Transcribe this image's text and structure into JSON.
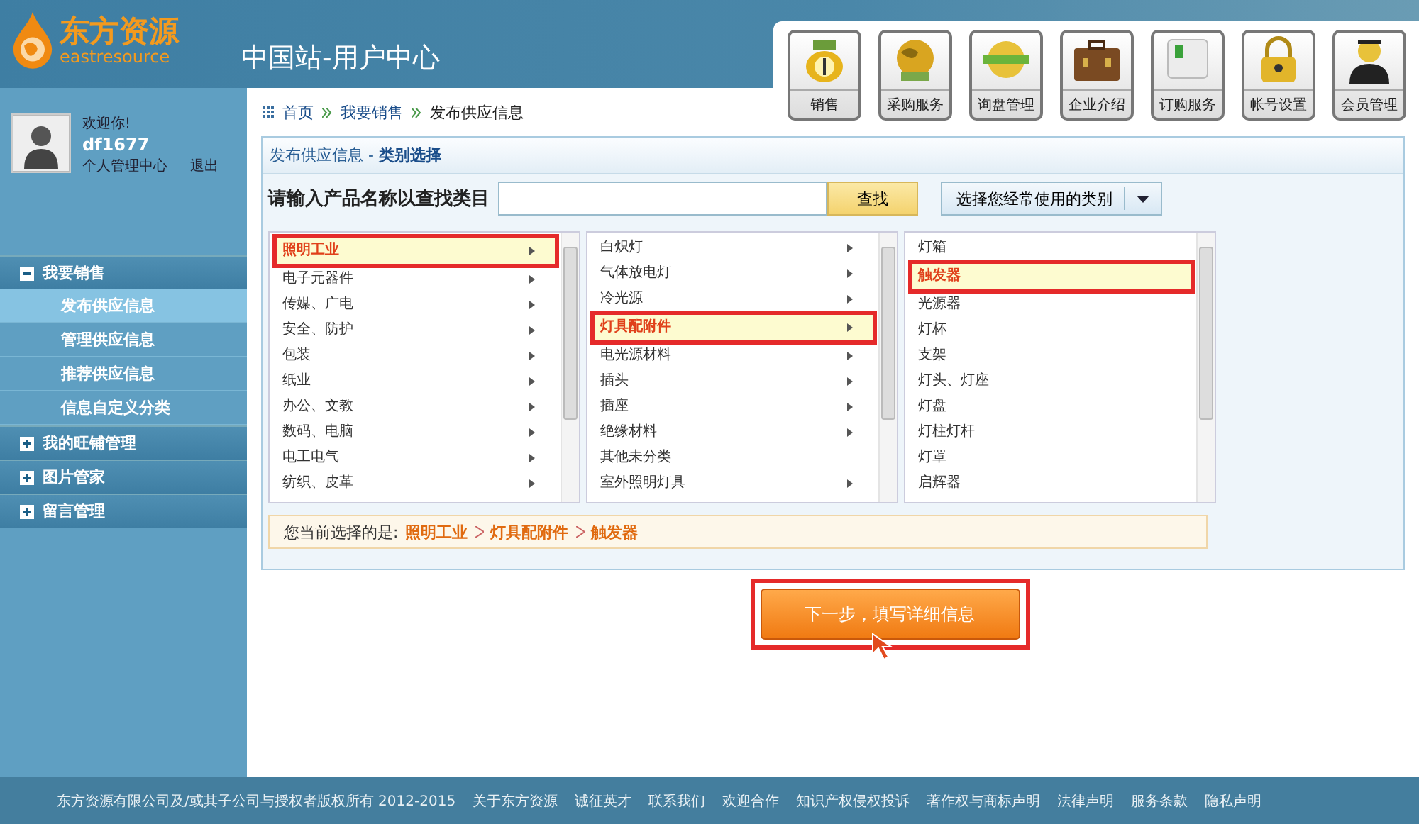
{
  "header": {
    "logo_cn": "东方资源",
    "logo_en": "eastresource",
    "site_title": "中国站-用户中心"
  },
  "nav_tiles": [
    {
      "label": "销售"
    },
    {
      "label": "采购服务"
    },
    {
      "label": "询盘管理"
    },
    {
      "label": "企业介绍"
    },
    {
      "label": "订购服务"
    },
    {
      "label": "帐号设置"
    },
    {
      "label": "会员管理"
    }
  ],
  "user": {
    "greeting": "欢迎你!",
    "name": "df1677",
    "center_link": "个人管理中心",
    "logout": "退出"
  },
  "sidebar": [
    {
      "label": "我要销售",
      "expanded": true,
      "children": [
        {
          "label": "发布供应信息",
          "selected": true
        },
        {
          "label": "管理供应信息",
          "selected": false
        },
        {
          "label": "推荐供应信息",
          "selected": false
        },
        {
          "label": "信息自定义分类",
          "selected": false
        }
      ]
    },
    {
      "label": "我的旺铺管理",
      "expanded": false
    },
    {
      "label": "图片管家",
      "expanded": false
    },
    {
      "label": "留言管理",
      "expanded": false
    }
  ],
  "breadcrumb": [
    "首页",
    "我要销售",
    "发布供应信息"
  ],
  "panel": {
    "title": "发布供应信息 - **类别选择**",
    "search_label": "请输入产品名称以查找类目",
    "search_button": "查找",
    "common_dropdown": "选择您经常使用的类别"
  },
  "category_columns": [
    {
      "items": [
        {
          "label": "照明工业",
          "selected": true,
          "has_children": true
        },
        {
          "label": "电子元器件",
          "selected": false,
          "has_children": true
        },
        {
          "label": "传媒、广电",
          "selected": false,
          "has_children": true
        },
        {
          "label": "安全、防护",
          "selected": false,
          "has_children": true
        },
        {
          "label": "包装",
          "selected": false,
          "has_children": true
        },
        {
          "label": "纸业",
          "selected": false,
          "has_children": true
        },
        {
          "label": "办公、文教",
          "selected": false,
          "has_children": true
        },
        {
          "label": "数码、电脑",
          "selected": false,
          "has_children": true
        },
        {
          "label": "电工电气",
          "selected": false,
          "has_children": true
        },
        {
          "label": "纺织、皮革",
          "selected": false,
          "has_children": true
        }
      ]
    },
    {
      "items": [
        {
          "label": "白炽灯",
          "selected": false,
          "has_children": true
        },
        {
          "label": "气体放电灯",
          "selected": false,
          "has_children": true
        },
        {
          "label": "冷光源",
          "selected": false,
          "has_children": true
        },
        {
          "label": "灯具配附件",
          "selected": true,
          "has_children": true
        },
        {
          "label": "电光源材料",
          "selected": false,
          "has_children": true
        },
        {
          "label": "插头",
          "selected": false,
          "has_children": true
        },
        {
          "label": "插座",
          "selected": false,
          "has_children": true
        },
        {
          "label": "绝缘材料",
          "selected": false,
          "has_children": true
        },
        {
          "label": "其他未分类",
          "selected": false,
          "has_children": false
        },
        {
          "label": "室外照明灯具",
          "selected": false,
          "has_children": true
        }
      ]
    },
    {
      "items": [
        {
          "label": "灯箱",
          "selected": false,
          "has_children": false
        },
        {
          "label": "触发器",
          "selected": true,
          "has_children": false
        },
        {
          "label": "光源器",
          "selected": false,
          "has_children": false
        },
        {
          "label": "灯杯",
          "selected": false,
          "has_children": false
        },
        {
          "label": "支架",
          "selected": false,
          "has_children": false
        },
        {
          "label": "灯头、灯座",
          "selected": false,
          "has_children": false
        },
        {
          "label": "灯盘",
          "selected": false,
          "has_children": false
        },
        {
          "label": "灯柱灯杆",
          "selected": false,
          "has_children": false
        },
        {
          "label": "灯罩",
          "selected": false,
          "has_children": false
        },
        {
          "label": "启辉器",
          "selected": false,
          "has_children": false
        }
      ]
    }
  ],
  "current_selection": {
    "label": "您当前选择的是:",
    "path": [
      "照明工业",
      "灯具配附件",
      "触发器"
    ]
  },
  "next_button": "下一步，填写详细信息",
  "footer": {
    "copyright": "东方资源有限公司及/或其子公司与授权者版权所有 2012-2015",
    "links": [
      "关于东方资源",
      "诚征英才",
      "联系我们",
      "欢迎合作",
      "知识产权侵权投诉",
      "著作权与商标声明",
      "法律声明",
      "服务条款",
      "隐私声明"
    ]
  }
}
